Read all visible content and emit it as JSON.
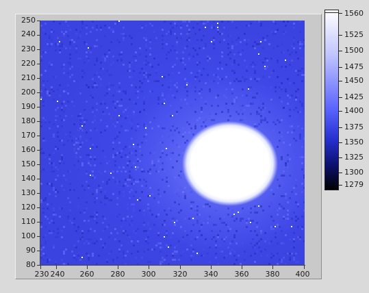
{
  "plot": {
    "y_ticks": [
      "250",
      "240",
      "230",
      "220",
      "210",
      "200",
      "190",
      "180",
      "170",
      "160",
      "150",
      "140",
      "130",
      "120",
      "110",
      "100",
      "90",
      "80"
    ],
    "x_ticks": [
      "230",
      "240",
      "260",
      "280",
      "300",
      "320",
      "340",
      "360",
      "380",
      "400"
    ]
  },
  "colorbar": {
    "labels": [
      "1560",
      "1525",
      "1500",
      "1475",
      "1450",
      "1425",
      "1400",
      "1375",
      "1350",
      "1325",
      "1300",
      "1279"
    ],
    "colors": [
      "#ffffff",
      "#bfc4ff",
      "#5a64ff",
      "#2630d0",
      "#0d1170",
      "#000000"
    ]
  }
}
